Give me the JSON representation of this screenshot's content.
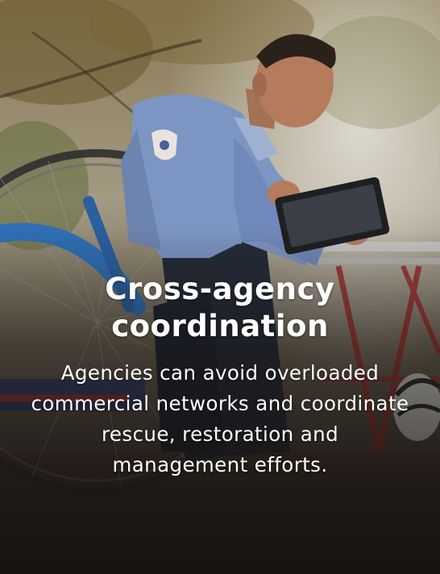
{
  "card": {
    "heading": "Cross-agency coordination",
    "body": "Agencies can avoid overloaded commercial networks and coordinate rescue, restoration and management efforts.",
    "photo_icon": "paramedic-with-tablet-photo"
  }
}
